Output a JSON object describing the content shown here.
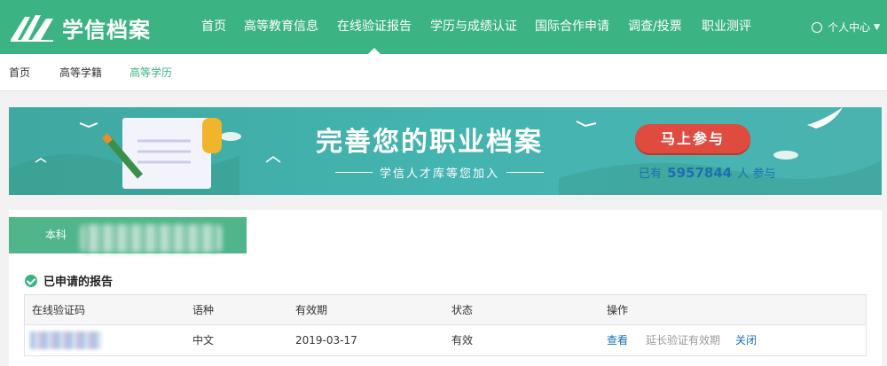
{
  "brand": {
    "name": "学信档案"
  },
  "nav": {
    "items": [
      {
        "label": "首页"
      },
      {
        "label": "高等教育信息"
      },
      {
        "label": "在线验证报告",
        "active": true
      },
      {
        "label": "学历与成绩认证"
      },
      {
        "label": "国际合作申请"
      },
      {
        "label": "调查/投票"
      },
      {
        "label": "职业测评"
      }
    ],
    "user_center": "个人中心",
    "user_icon": "user-circle-icon"
  },
  "subnav": {
    "items": [
      {
        "label": "首页"
      },
      {
        "label": "高等学籍"
      },
      {
        "label": "高等学历",
        "active": true
      }
    ]
  },
  "banner": {
    "title": "完善您的职业档案",
    "subtitle": "学信人才库等您加入",
    "button": "马上参与",
    "count_prefix": "已有",
    "count": "5957844",
    "count_suffix": "人 参与"
  },
  "degree_tab": {
    "label": "本科"
  },
  "reports": {
    "title": "已申请的报告",
    "columns": [
      "在线验证码",
      "语种",
      "有效期",
      "状态",
      "操作"
    ],
    "rows": [
      {
        "language": "中文",
        "expiry": "2019-03-17",
        "status": "有效",
        "actions": {
          "view": "查看",
          "extend": "延长验证有效期",
          "close": "关闭"
        }
      }
    ]
  },
  "colors": {
    "primary": "#3cb383",
    "link": "#1d6fb0",
    "button": "#e04b3f"
  }
}
